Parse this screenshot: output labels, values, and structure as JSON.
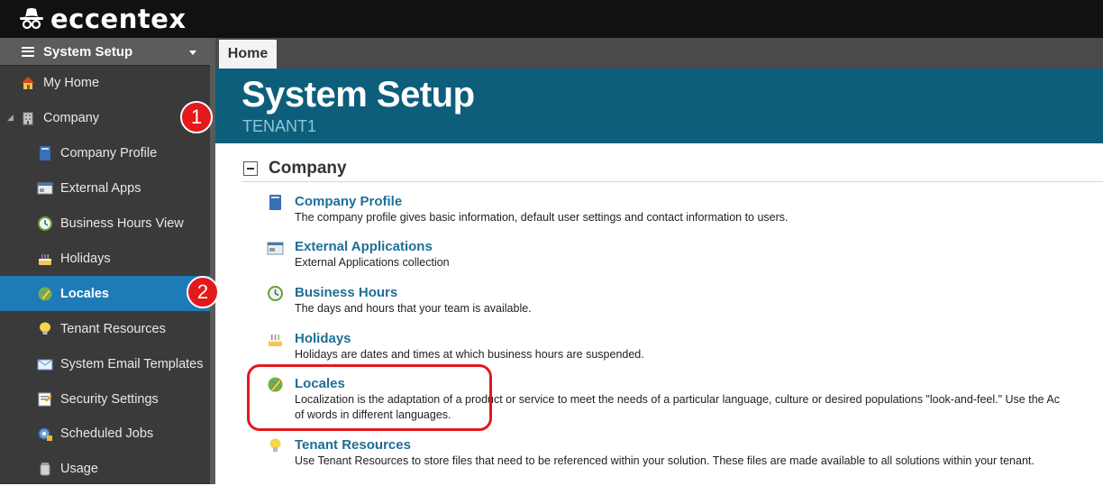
{
  "app": {
    "brand": "eccentex"
  },
  "sidebar": {
    "header": "System Setup",
    "items": [
      {
        "label": "My Home",
        "icon": "home-icon"
      },
      {
        "label": "Company",
        "icon": "building-icon"
      },
      {
        "label": "Company Profile",
        "icon": "book-icon"
      },
      {
        "label": "External Apps",
        "icon": "window-app-icon"
      },
      {
        "label": "Business Hours View",
        "icon": "clock-icon"
      },
      {
        "label": "Holidays",
        "icon": "cake-icon"
      },
      {
        "label": "Locales",
        "icon": "globe-pencil-icon",
        "active": true
      },
      {
        "label": "Tenant Resources",
        "icon": "lightbulb-icon"
      },
      {
        "label": "System Email Templates",
        "icon": "envelope-icon"
      },
      {
        "label": "Security Settings",
        "icon": "security-form-icon"
      },
      {
        "label": "Scheduled Jobs",
        "icon": "scheduled-gear-icon"
      },
      {
        "label": "Usage",
        "icon": "usage-jar-icon"
      }
    ]
  },
  "annotations": {
    "badge1": "1",
    "badge2": "2"
  },
  "tabs": {
    "home": "Home"
  },
  "banner": {
    "title": "System Setup",
    "subtitle": "TENANT1"
  },
  "section": {
    "title": "Company"
  },
  "entries": [
    {
      "title": "Company Profile",
      "desc": "The company profile gives basic information, default user settings and contact information to users."
    },
    {
      "title": "External Applications",
      "desc": "External Applications collection"
    },
    {
      "title": "Business Hours",
      "desc": "The days and hours that your team is available."
    },
    {
      "title": "Holidays",
      "desc": "Holidays are dates and times at which business hours are suspended."
    },
    {
      "title": "Locales",
      "desc": "Localization is the adaptation of a product or service to meet the needs of a particular language, culture or desired populations \"look-and-feel.\" Use the Ac",
      "desc2": "of words in different languages."
    },
    {
      "title": "Tenant Resources",
      "desc": "Use Tenant Resources to store files that need to be referenced within your solution. These files are made available to all solutions within your tenant."
    }
  ],
  "colors": {
    "accent": "#1e7bb8",
    "banner": "#0d5e7a",
    "link": "#1f6e96",
    "annotation": "#e3191c"
  }
}
